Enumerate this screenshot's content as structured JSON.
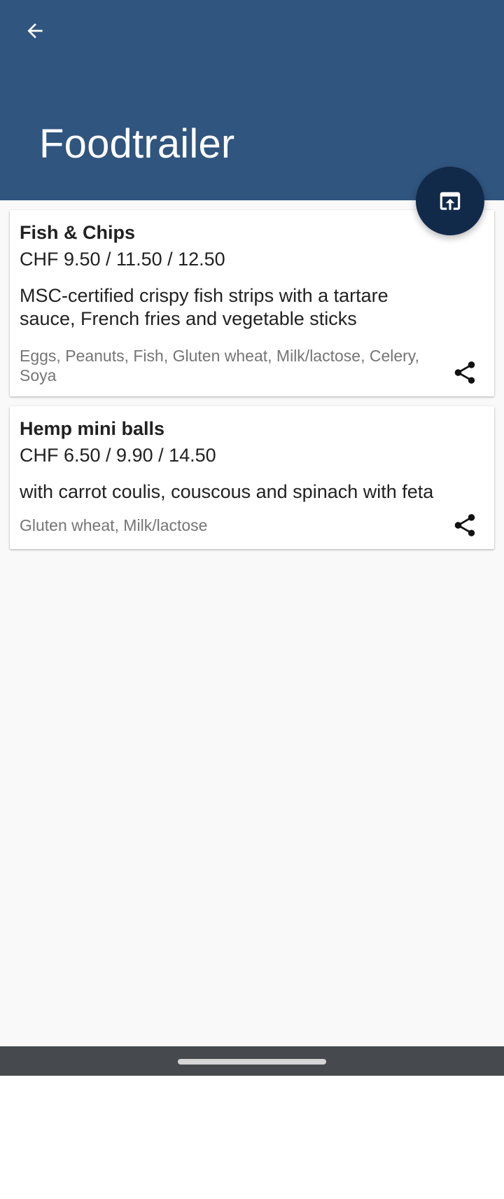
{
  "app_bar": {
    "title": "Foodtrailer",
    "back_icon": "arrow-back-icon",
    "fab_icon": "open-in-browser-icon",
    "background_color": "#30557f",
    "fab_color": "#122a4a"
  },
  "menu": {
    "items": [
      {
        "name": "Fish & Chips",
        "price": "CHF 9.50 / 11.50 / 12.50",
        "description": "MSC-certified crispy fish strips with a tartare sauce, French fries and vegetable sticks",
        "allergens": "Eggs, Peanuts, Fish, Gluten wheat, Milk/lactose, Celery, Soya",
        "share_icon": "share-icon"
      },
      {
        "name": "Hemp mini balls",
        "price": "CHF 6.50 / 9.90 / 14.50",
        "description": "with carrot coulis, couscous and spinach with feta",
        "allergens": "Gluten wheat, Milk/lactose",
        "share_icon": "share-icon"
      }
    ]
  },
  "system_nav": {
    "background_color": "#464a4f"
  }
}
